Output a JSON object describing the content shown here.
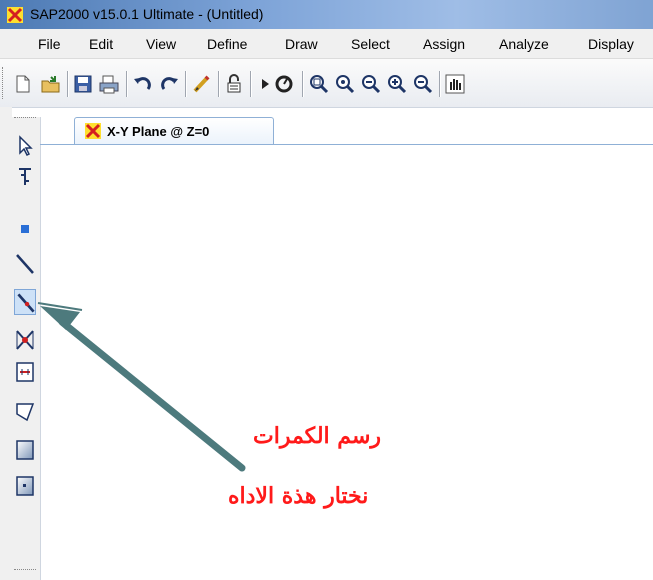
{
  "window": {
    "title": "SAP2000 v15.0.1 Ultimate  - (Untitled)"
  },
  "menu": {
    "items": [
      "File",
      "Edit",
      "View",
      "Define",
      "Draw",
      "Select",
      "Assign",
      "Analyze",
      "Display"
    ]
  },
  "toolbar": {
    "icons": [
      "new-file-icon",
      "open-folder-icon",
      "save-icon",
      "print-icon",
      "undo-icon",
      "redo-icon",
      "pencil-icon",
      "lock-icon",
      "run-icon",
      "refresh-view-icon",
      "zoom-window-icon",
      "zoom-in-icon",
      "zoom-restore-icon",
      "zoom-in-step-icon",
      "zoom-out-icon",
      "pan-hand-icon"
    ]
  },
  "left_toolbar": {
    "icons": [
      "pointer-icon",
      "joint-reshape-icon",
      "special-joint-icon",
      "draw-frame-icon",
      "quick-draw-frame-icon",
      "quick-draw-braces-icon",
      "quick-draw-secondary-beams-icon",
      "draw-poly-area-icon",
      "draw-rect-area-icon",
      "quick-draw-area-icon"
    ]
  },
  "tab": {
    "label": "X-Y Plane @ Z=0"
  },
  "annotation": {
    "line1": "رسم الكمرات",
    "line2": "نختار هذة الاداه",
    "color": "#ff1a1a",
    "arrow_color": "#5a8a8c"
  }
}
